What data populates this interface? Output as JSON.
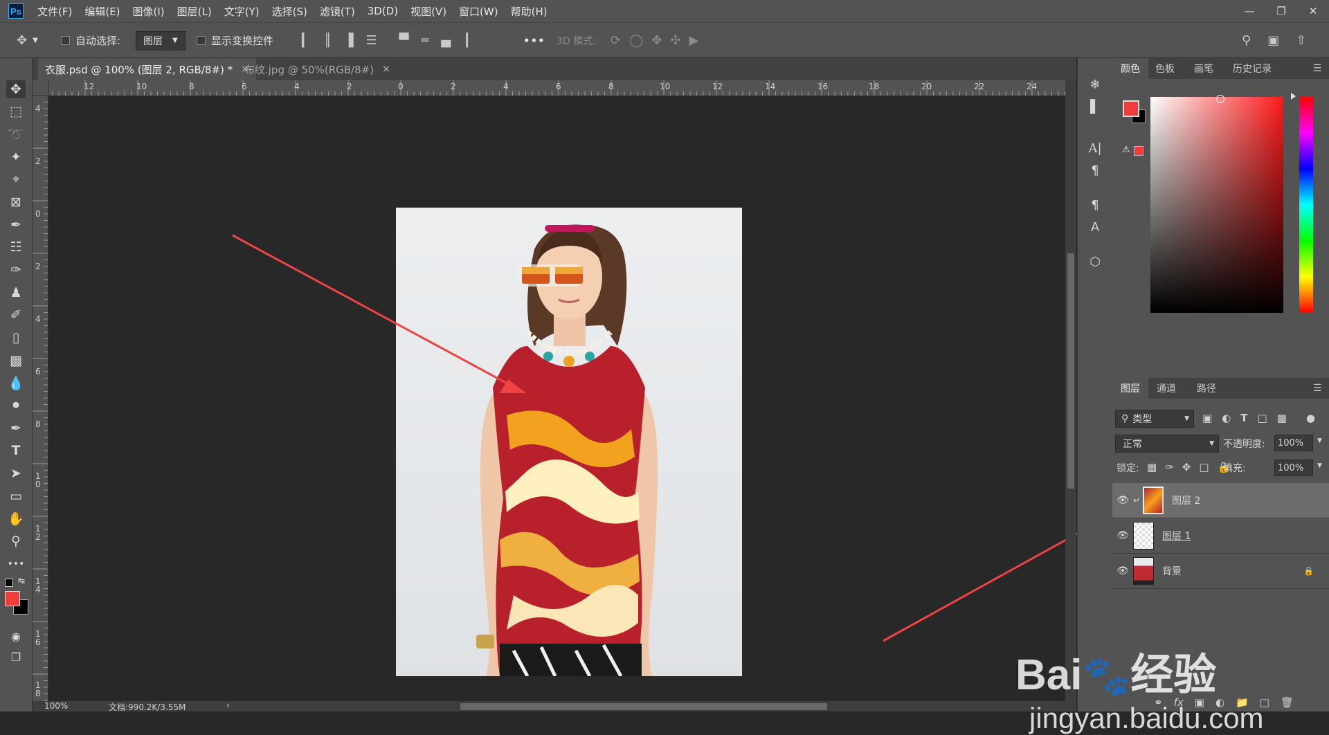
{
  "app": {
    "logo": "Ps"
  },
  "menu": [
    "文件(F)",
    "编辑(E)",
    "图像(I)",
    "图层(L)",
    "文字(Y)",
    "选择(S)",
    "滤镜(T)",
    "3D(D)",
    "视图(V)",
    "窗口(W)",
    "帮助(H)"
  ],
  "options": {
    "auto_select_label": "自动选择:",
    "auto_select_value": "图层",
    "show_transform_label": "显示变换控件",
    "mode3d_label": "3D 模式:",
    "more": "•••"
  },
  "tabs": [
    {
      "label": "衣服.psd @ 100% (图层 2, RGB/8#) *",
      "close": "×"
    },
    {
      "label": "布纹.jpg @ 50%(RGB/8#)",
      "close": "×"
    }
  ],
  "ruler": {
    "h": [
      "12",
      "10",
      "8",
      "6",
      "4",
      "2",
      "0",
      "2",
      "4",
      "6",
      "8",
      "10",
      "12",
      "14",
      "16",
      "18",
      "20",
      "22",
      "24"
    ],
    "v": [
      "4",
      "2",
      "0",
      "2",
      "4",
      "6",
      "8",
      "1 0",
      "1 2",
      "1 4",
      "1 6",
      "1 8"
    ]
  },
  "status": {
    "zoom": "100%",
    "doc": "文档:990.2K/3.55M"
  },
  "color_panel": {
    "tabs": [
      "颜色",
      "色板",
      "画笔",
      "历史记录"
    ],
    "foreground": "#f23b3b",
    "background": "#000000"
  },
  "layers_panel": {
    "tabs": [
      "图层",
      "通道",
      "路径"
    ],
    "filter_label": "类型",
    "blend_mode": "正常",
    "opacity_label": "不透明度:",
    "opacity_value": "100%",
    "lock_label": "锁定:",
    "fill_label": "填充:",
    "fill_value": "100%",
    "layers": [
      {
        "name": "图层 2",
        "selected": true
      },
      {
        "name": "图层 1",
        "selected": false
      },
      {
        "name": "背景",
        "selected": false
      }
    ]
  },
  "watermark": {
    "brand": "Bai",
    "brand2": "经验",
    "url": "jingyan.baidu.com"
  }
}
